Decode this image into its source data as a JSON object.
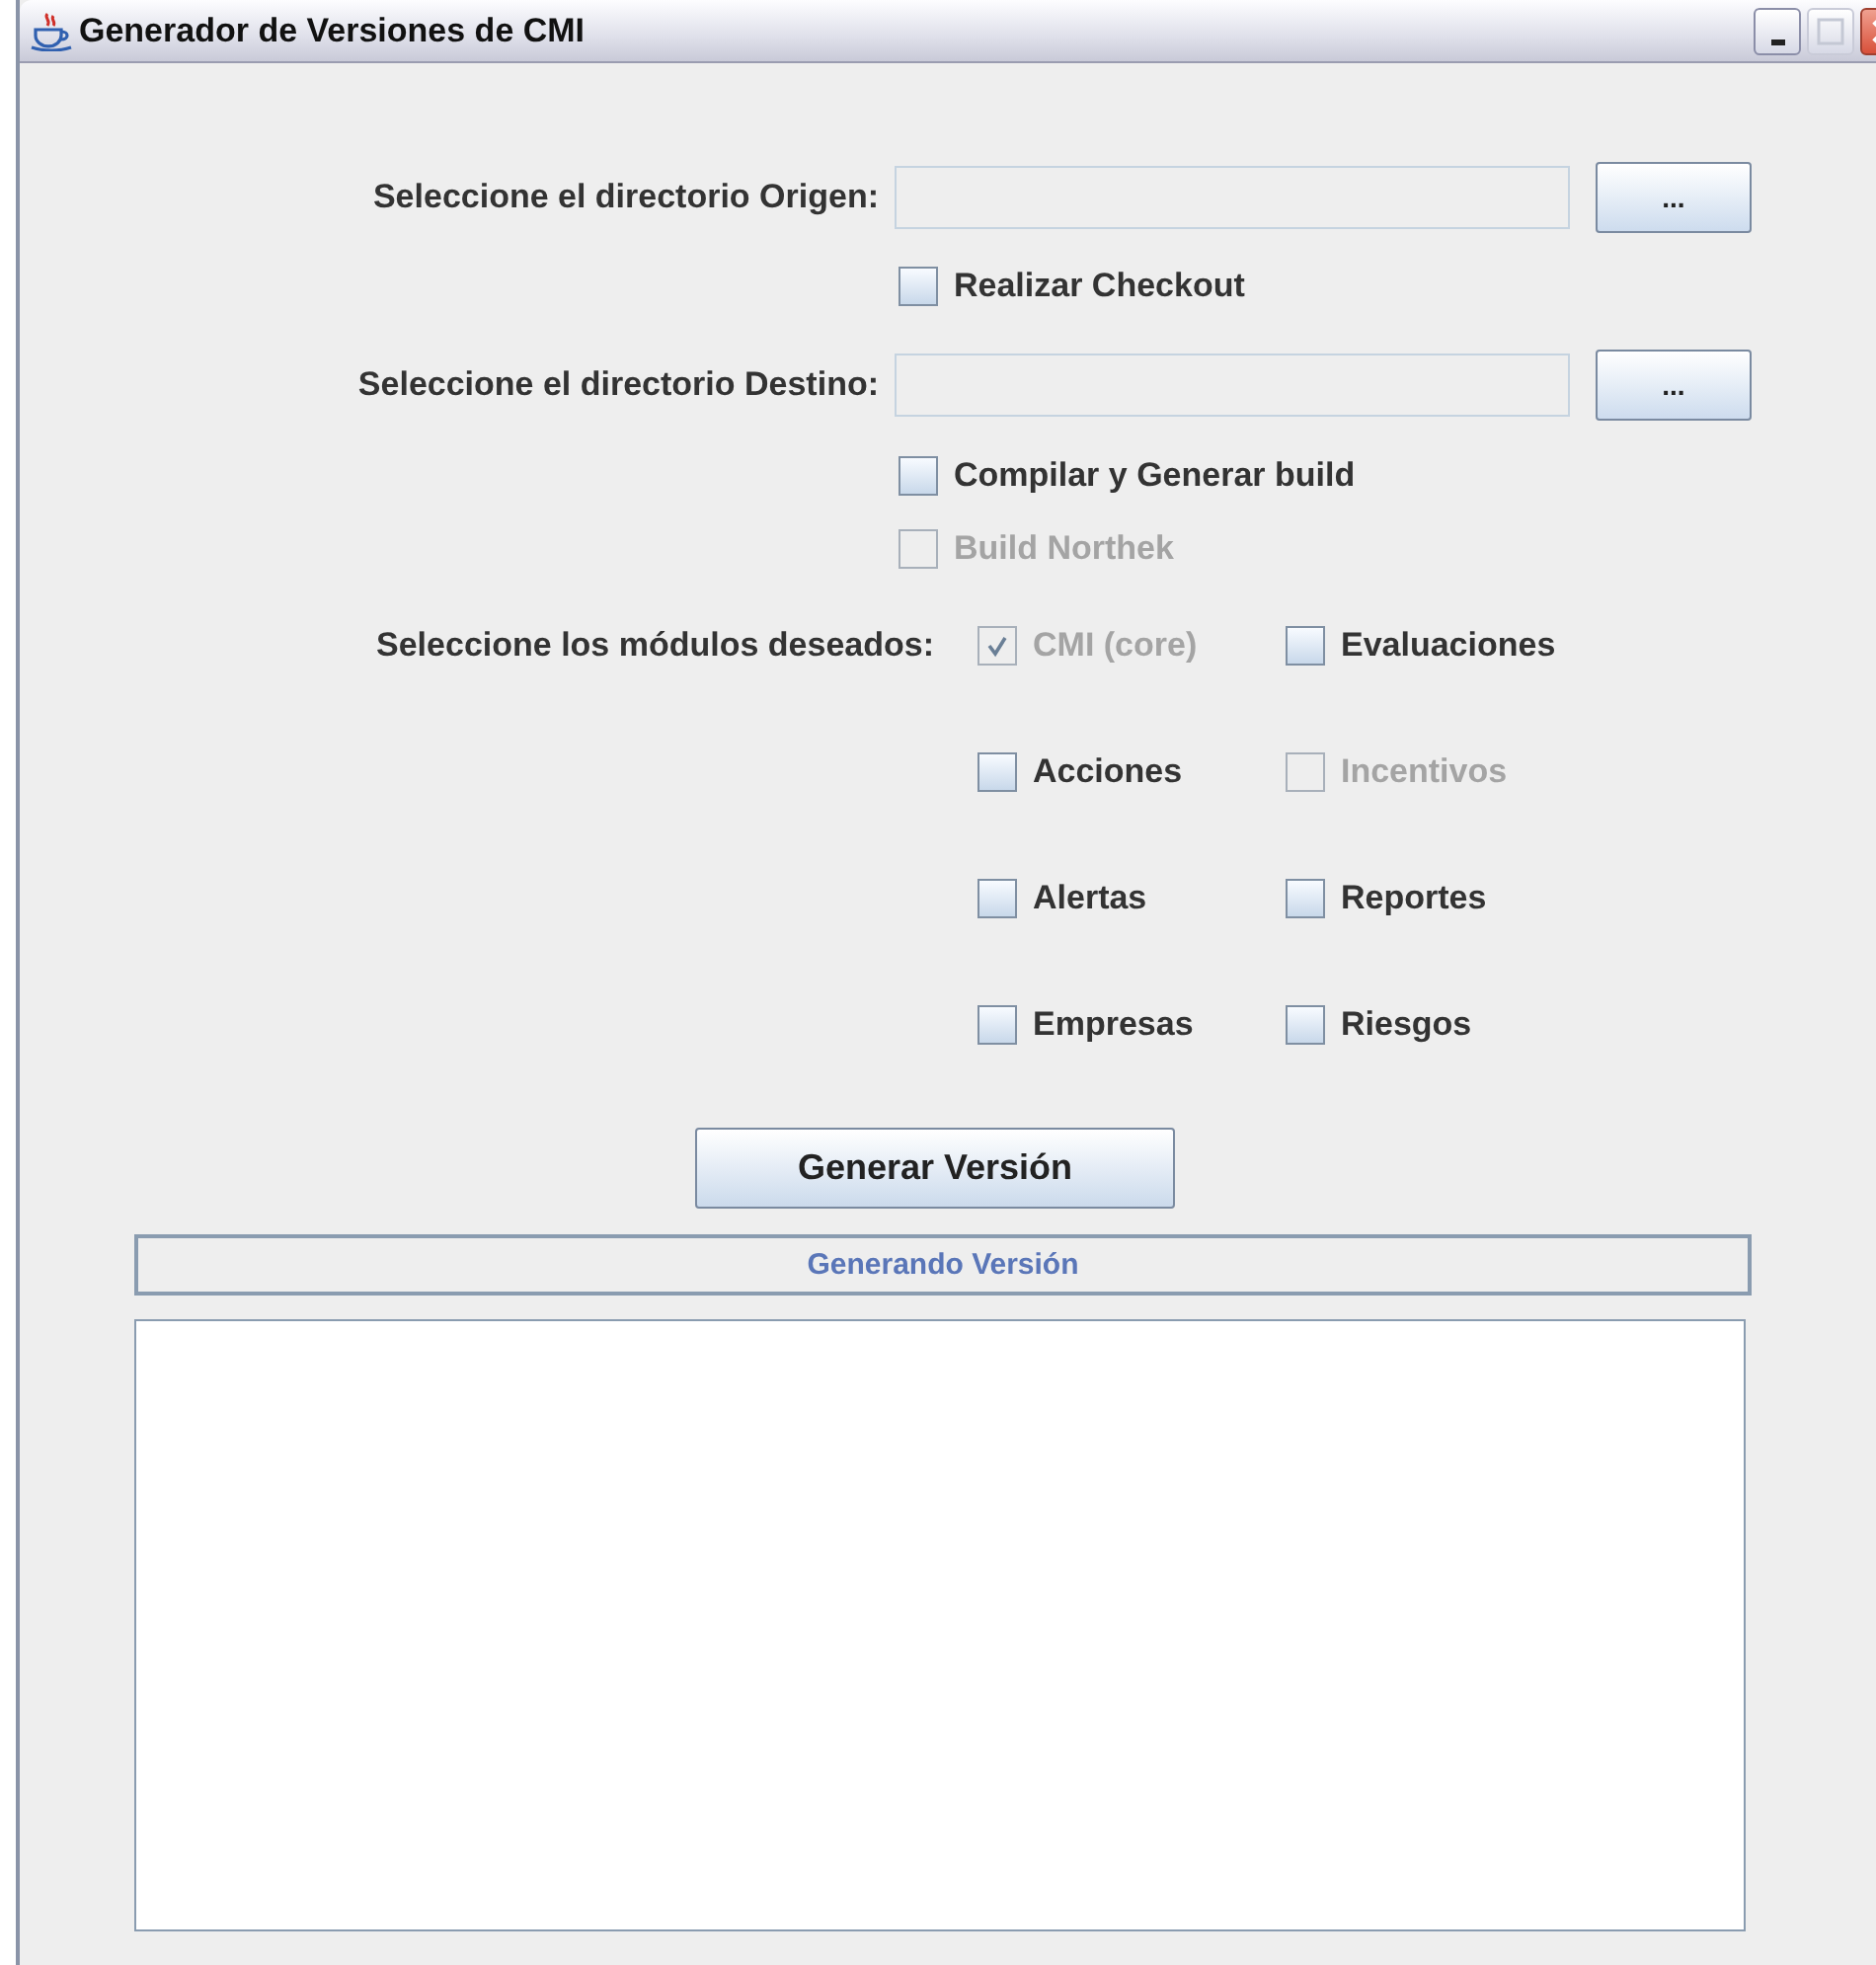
{
  "window": {
    "title": "Generador de Versiones de CMI"
  },
  "source": {
    "label": "Seleccione el directorio Origen:",
    "browse": "...",
    "options": [
      {
        "label": "Realizar Checkout",
        "checked": false,
        "disabled": false
      }
    ]
  },
  "destination": {
    "label": "Seleccione el directorio Destino:",
    "browse": "...",
    "options": [
      {
        "label": "Compilar y Generar build",
        "checked": false,
        "disabled": false
      },
      {
        "label": "Build Northek",
        "checked": false,
        "disabled": true
      }
    ]
  },
  "modules": {
    "label": "Seleccione los módulos deseados:",
    "items": [
      {
        "label": "CMI (core)",
        "checked": true,
        "disabled": true
      },
      {
        "label": "Evaluaciones",
        "checked": false,
        "disabled": false
      },
      {
        "label": "Acciones",
        "checked": false,
        "disabled": false
      },
      {
        "label": "Incentivos",
        "checked": false,
        "disabled": true
      },
      {
        "label": "Alertas",
        "checked": false,
        "disabled": false
      },
      {
        "label": "Reportes",
        "checked": false,
        "disabled": false
      },
      {
        "label": "Empresas",
        "checked": false,
        "disabled": false
      },
      {
        "label": "Riesgos",
        "checked": false,
        "disabled": false
      }
    ]
  },
  "generate_button": "Generar Versión",
  "progress": {
    "label": "Generando Versión",
    "level": 0
  }
}
